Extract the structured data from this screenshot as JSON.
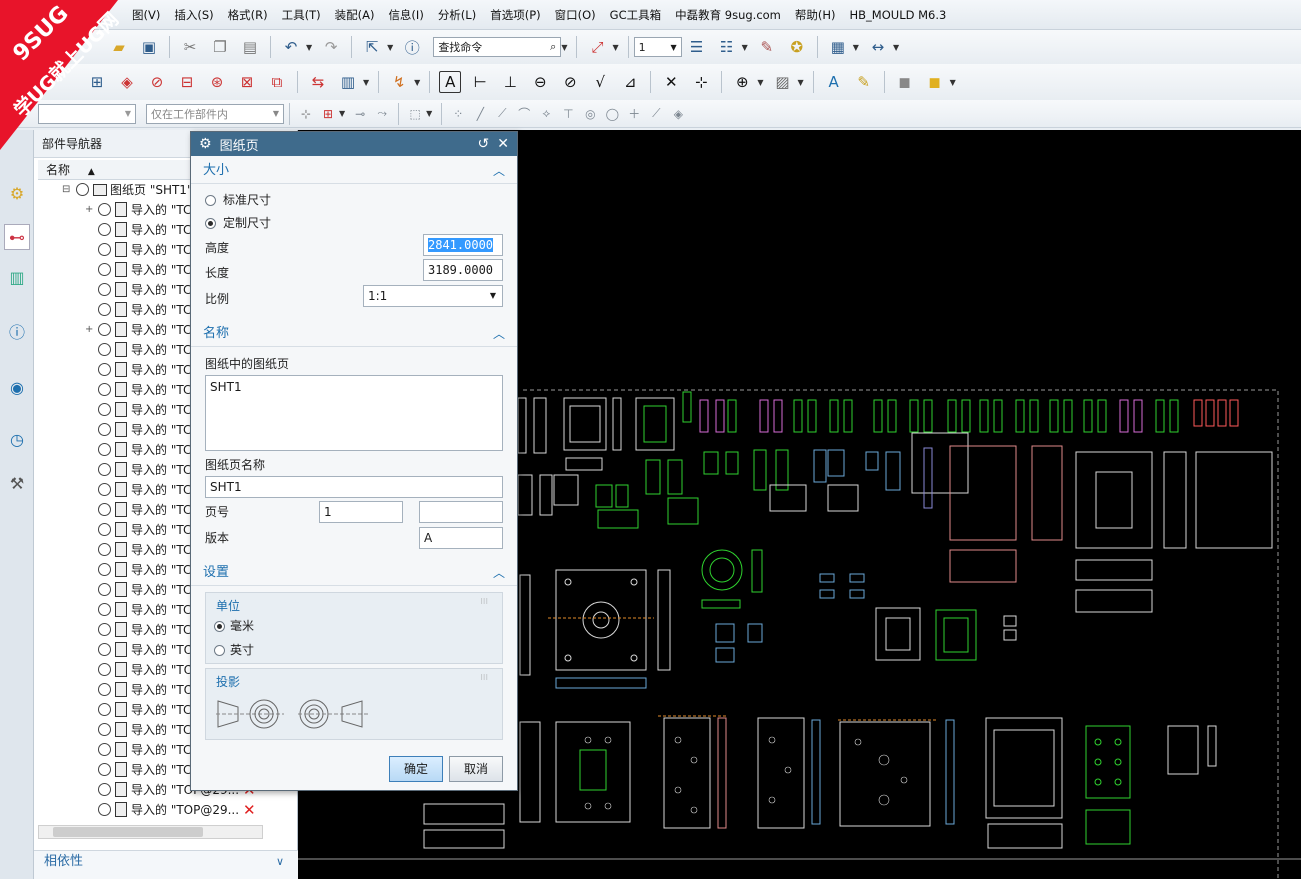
{
  "watermark": {
    "brand": "9SUG",
    "slogan": "学UG就上UG网"
  },
  "menu": [
    "图(V)",
    "插入(S)",
    "格式(R)",
    "工具(T)",
    "装配(A)",
    "信息(I)",
    "分析(L)",
    "首选项(P)",
    "窗口(O)",
    "GC工具箱",
    "中磊教育 9sug.com",
    "帮助(H)",
    "HB_MOULD M6.3"
  ],
  "toolbar": {
    "search_placeholder": "查找命令",
    "layer_value": "1",
    "filter_value": "仅在工作部件内"
  },
  "navigator": {
    "title": "部件导航器",
    "column_name": "名称",
    "root": "图纸页 \"SHT1\"",
    "rows": [
      "导入的 \"TC",
      "导入的 \"TC",
      "导入的 \"TC",
      "导入的 \"TC",
      "导入的 \"TC",
      "导入的 \"TC",
      "导入的 \"TC",
      "导入的 \"TC",
      "导入的 \"TC",
      "导入的 \"TC",
      "导入的 \"TC",
      "导入的 \"TC",
      "导入的 \"TC",
      "导入的 \"TC",
      "导入的 \"TC",
      "导入的 \"TC",
      "导入的 \"TC",
      "导入的 \"TC",
      "导入的 \"TC",
      "导入的 \"TC",
      "导入的 \"TC",
      "导入的 \"TC",
      "导入的 \"TOP",
      "导入的 \"TOP",
      "导入的 \"TOP",
      "导入的 \"TC",
      "导入的 \"TC",
      "导入的 \"TC",
      "导入的 \"TC",
      "导入的 \"TOP@29...",
      "导入的 \"TOP@29..."
    ],
    "dependency": "相依性"
  },
  "dialog": {
    "title": "图纸页",
    "size_section": "大小",
    "standard_size": "标准尺寸",
    "custom_size": "定制尺寸",
    "height_label": "高度",
    "height_value": "2841.0000",
    "length_label": "长度",
    "length_value": "3189.0000",
    "scale_label": "比例",
    "scale_value": "1:1",
    "name_section": "名称",
    "sheets_in_drawing": "图纸中的图纸页",
    "sheet_list": "SHT1",
    "sheet_name_label": "图纸页名称",
    "sheet_name": "SHT1",
    "page_label": "页号",
    "page_value": "1",
    "revision_label": "版本",
    "revision_value": "A",
    "settings_section": "设置",
    "units_label": "单位",
    "unit_mm": "毫米",
    "unit_inch": "英寸",
    "projection_label": "投影",
    "ok": "确定",
    "cancel": "取消"
  }
}
